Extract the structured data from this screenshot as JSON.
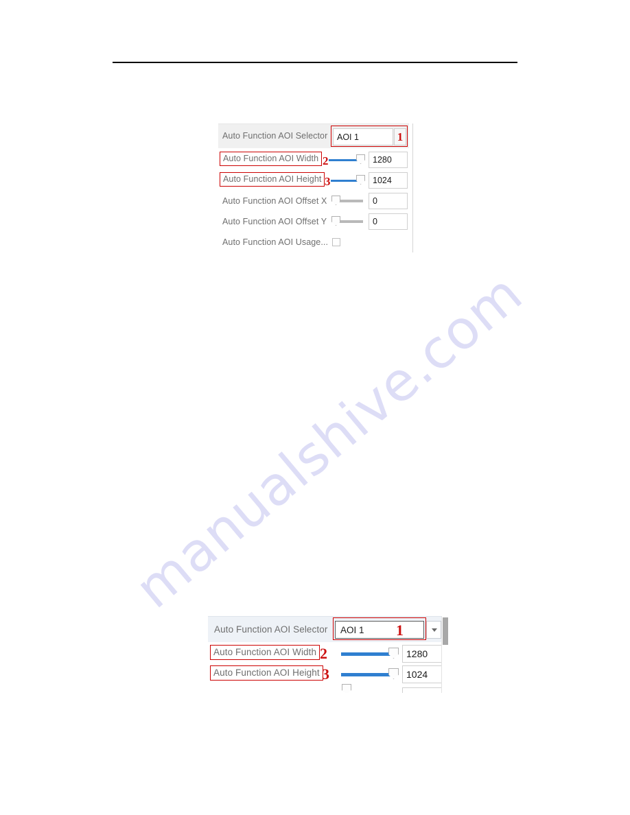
{
  "page": {
    "watermark_text": "manualshive.com",
    "watermark_color": "#c9c9f2",
    "rule_color": "#000000"
  },
  "panel_top": {
    "accent_slider_color": "#2f7fd0",
    "annotation_color": "#cc0000",
    "selector": {
      "label": "Auto Function AOI Selector",
      "value": "AOI 1",
      "annotation": "1"
    },
    "rows": [
      {
        "label": "Auto Function AOI Width",
        "value": "1280",
        "annotation": "2",
        "slider_fill_pct": 82,
        "boxed": true
      },
      {
        "label": "Auto Function AOI Height",
        "value": "1024",
        "annotation": "3",
        "slider_fill_pct": 82,
        "boxed": true
      },
      {
        "label": "Auto Function AOI Offset X",
        "value": "0",
        "annotation": "",
        "slider_fill_pct": 0,
        "boxed": false
      },
      {
        "label": "Auto Function AOI Offset Y",
        "value": "0",
        "annotation": "",
        "slider_fill_pct": 0,
        "boxed": false
      }
    ],
    "usage": {
      "label": "Auto Function AOI Usage...",
      "checked": false
    }
  },
  "panel_bottom": {
    "accent_slider_color": "#2f7fd0",
    "annotation_color": "#cc0000",
    "selector": {
      "label": "Auto Function AOI Selector",
      "value": "AOI 1",
      "annotation": "1",
      "dropdown_icon": "chevron-down-icon"
    },
    "rows": [
      {
        "label": "Auto Function AOI Width",
        "value": "1280",
        "annotation": "2",
        "slider_fill_pct": 82
      },
      {
        "label": "Auto Function AOI Height",
        "value": "1024",
        "annotation": "3",
        "slider_fill_pct": 82
      }
    ]
  }
}
